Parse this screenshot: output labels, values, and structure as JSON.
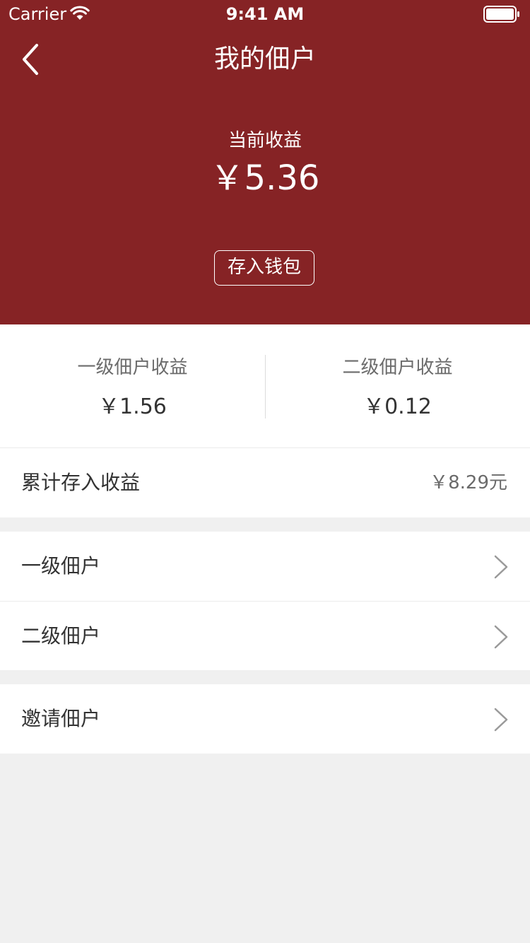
{
  "status_bar": {
    "carrier": "Carrier",
    "time": "9:41 AM"
  },
  "nav": {
    "title": "我的佃户"
  },
  "earnings": {
    "current_label": "当前收益",
    "current_amount": "￥5.36",
    "deposit_button": "存入钱包"
  },
  "summary": {
    "level1_label": "一级佃户收益",
    "level1_value": "￥1.56",
    "level2_label": "二级佃户收益",
    "level2_value": "￥0.12"
  },
  "cumulative": {
    "label": "累计存入收益",
    "value": "￥8.29元"
  },
  "menu": {
    "level1": "一级佃户",
    "level2": "二级佃户",
    "invite": "邀请佃户"
  },
  "colors": {
    "header_bg": "#862325",
    "page_bg": "#f0f0f0"
  },
  "icons": [
    "back-arrow-icon",
    "wifi-icon",
    "battery-icon",
    "chevron-right-icon"
  ]
}
